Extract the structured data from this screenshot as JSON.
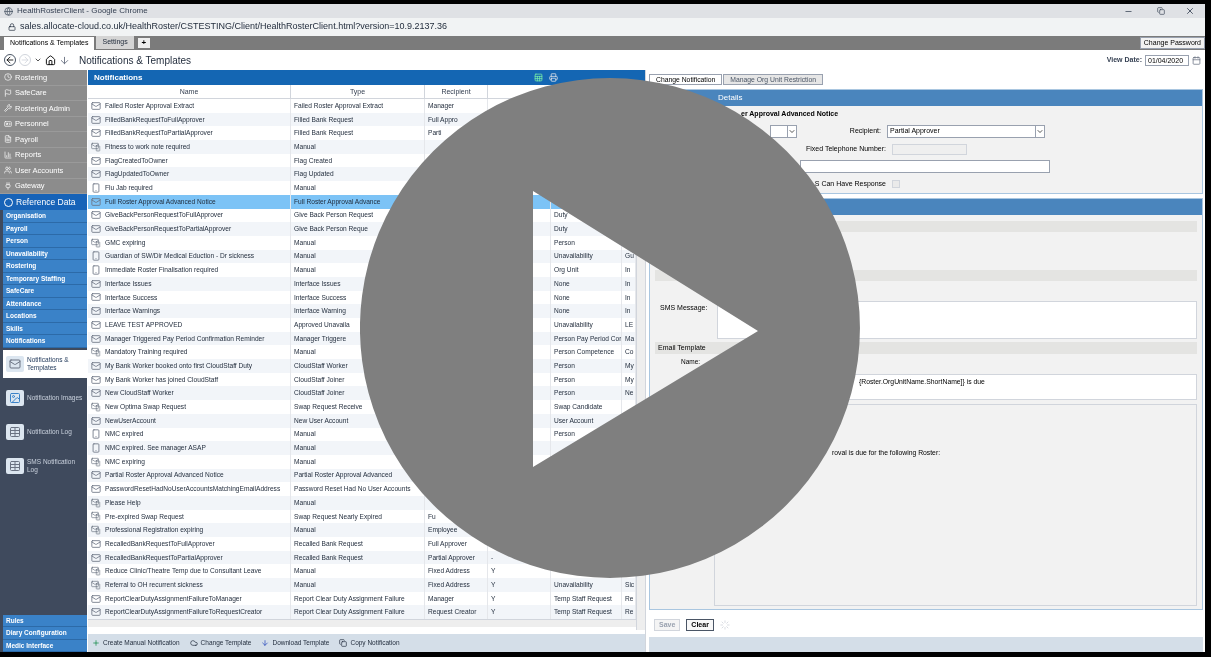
{
  "browser": {
    "title": "HealthRosterClient - Google Chrome",
    "url": "sales.allocate-cloud.co.uk/HealthRoster/CSTESTING/Client/HealthRosterClient.html?version=10.9.2137.36"
  },
  "app_tabs": [
    {
      "label": "Notifications & Templates",
      "selected": true
    },
    {
      "label": "Settings",
      "selected": false
    }
  ],
  "add_tab": "+",
  "change_password": "Change Password",
  "toolbar": {
    "title": "Notifications & Templates",
    "view_date_label": "View Date:",
    "view_date": "01/04/2020"
  },
  "sidebar": {
    "modules": [
      {
        "label": "Rostering"
      },
      {
        "label": "SafeCare"
      },
      {
        "label": "Rostering Admin"
      },
      {
        "label": "Personnel"
      },
      {
        "label": "Payroll"
      },
      {
        "label": "Reports"
      },
      {
        "label": "User Accounts"
      },
      {
        "label": "Gateway"
      }
    ],
    "reference": "Reference Data",
    "categories": [
      {
        "label": "Organisation"
      },
      {
        "label": "Payroll"
      },
      {
        "label": "Person"
      },
      {
        "label": "Unavailability"
      },
      {
        "label": "Rostering"
      },
      {
        "label": "Temporary Staffing"
      },
      {
        "label": "SafeCare"
      },
      {
        "label": "Attendance"
      },
      {
        "label": "Locations"
      },
      {
        "label": "Skills"
      },
      {
        "label": "Notifications"
      }
    ],
    "pages": [
      {
        "label": "Notifications & Templates",
        "selected": true
      },
      {
        "label": "Notification Images",
        "selected": false
      },
      {
        "label": "Notification Log",
        "selected": false
      },
      {
        "label": "SMS Notification Log",
        "selected": false
      }
    ],
    "bottom": [
      {
        "label": "Rules"
      },
      {
        "label": "Diary Configuration"
      },
      {
        "label": "Medic Interface"
      }
    ]
  },
  "grid": {
    "title": "Notifications",
    "columns": [
      "Name",
      "Type",
      "Recipient"
    ],
    "rows": [
      {
        "kind": "email",
        "selected": false,
        "cells": {
          "name": "Failed Roster Approval Extract",
          "type": "Failed Roster Approval Extract",
          "recipient": "Manager"
        }
      },
      {
        "kind": "email",
        "selected": false,
        "cells": {
          "name": "FilledBankRequestToFullApprover",
          "type": "Filled Bank Request",
          "recipient": "Full Appro"
        }
      },
      {
        "kind": "email",
        "selected": false,
        "cells": {
          "name": "FilledBankRequestToPartialApprover",
          "type": "Filled Bank Request",
          "recipient": "Parti"
        }
      },
      {
        "kind": "both",
        "selected": false,
        "cells": {
          "name": "Fitness to work note required",
          "type": "Manual"
        }
      },
      {
        "kind": "email",
        "selected": false,
        "cells": {
          "name": "FlagCreatedToOwner",
          "type": "Flag Created"
        }
      },
      {
        "kind": "email",
        "selected": false,
        "cells": {
          "name": "FlagUpdatedToOwner",
          "type": "Flag Updated"
        }
      },
      {
        "kind": "mobile",
        "selected": false,
        "cells": {
          "name": "Flu Jab required",
          "type": "Manual"
        }
      },
      {
        "kind": "email",
        "selected": true,
        "cells": {
          "name": "Full Roster Approval Advanced Notice",
          "type": "Full Roster Approval Advance"
        }
      },
      {
        "kind": "email",
        "selected": false,
        "cells": {
          "name": "GiveBackPersonRequestToFullApprover",
          "type": "Give Back Person Request",
          "column_5": "Duty"
        }
      },
      {
        "kind": "email",
        "selected": false,
        "cells": {
          "name": "GiveBackPersonRequestToPartialApprover",
          "type": "Give Back Person Reque",
          "column_5": "Duty"
        }
      },
      {
        "kind": "both",
        "selected": false,
        "cells": {
          "name": "GMC expiring",
          "type": "Manual",
          "column_5": "Person"
        }
      },
      {
        "kind": "mobile",
        "selected": false,
        "cells": {
          "name": "Guardian of SW/Dir Medical Eduction - Dr sickness",
          "type": "Manual",
          "column_5": "Unavailability",
          "column_6": "Gu"
        }
      },
      {
        "kind": "mobile",
        "selected": false,
        "cells": {
          "name": "Immediate Roster Finalisation required",
          "type": "Manual",
          "column_5": "Org Unit",
          "column_6": "In"
        }
      },
      {
        "kind": "email",
        "selected": false,
        "cells": {
          "name": "Interface Issues",
          "type": "Interface Issues",
          "column_5": "None",
          "column_6": "In"
        }
      },
      {
        "kind": "email",
        "selected": false,
        "cells": {
          "name": "Interface Success",
          "type": "Interface Success",
          "column_5": "None",
          "column_6": "In"
        }
      },
      {
        "kind": "email",
        "selected": false,
        "cells": {
          "name": "Interface Warnings",
          "type": "Interface Warning",
          "column_5": "None",
          "column_6": "In"
        }
      },
      {
        "kind": "email",
        "selected": false,
        "cells": {
          "name": "LEAVE TEST APPROVED",
          "type": "Approved Unavaila",
          "column_5": "Unavailability",
          "column_6": "LE"
        }
      },
      {
        "kind": "email",
        "selected": false,
        "cells": {
          "name": "Manager Triggered Pay Period Confirmation Reminder",
          "type": "Manager Triggere",
          "column_5": "Person Pay Period Cor",
          "column_6": "Ma"
        }
      },
      {
        "kind": "both",
        "selected": false,
        "cells": {
          "name": "Mandatory Training required",
          "type": "Manual",
          "column_5": "Person Competence",
          "column_6": "Co"
        }
      },
      {
        "kind": "email",
        "selected": false,
        "cells": {
          "name": "My Bank Worker booked onto first CloudStaff Duty",
          "type": "CloudStaff Worker",
          "column_5": "Person",
          "column_6": "My"
        }
      },
      {
        "kind": "email",
        "selected": false,
        "cells": {
          "name": "My Bank Worker has joined CloudStaff",
          "type": "CloudStaff Joiner",
          "column_5": "Person",
          "column_6": "My"
        }
      },
      {
        "kind": "email",
        "selected": false,
        "cells": {
          "name": "New CloudStaff Worker",
          "type": "CloudStaff Joiner",
          "column_5": "Person",
          "column_6": "Ne"
        }
      },
      {
        "kind": "both",
        "selected": false,
        "cells": {
          "name": "New Optima Swap Request",
          "type": "Swap Request Receive",
          "column_5": "Swap Candidate"
        }
      },
      {
        "kind": "email",
        "selected": false,
        "cells": {
          "name": "NewUserAccount",
          "type": "New User Account",
          "column_5": "User Account"
        }
      },
      {
        "kind": "mobile",
        "selected": false,
        "cells": {
          "name": "NMC expired",
          "type": "Manual",
          "column_5": "Person"
        }
      },
      {
        "kind": "mobile",
        "selected": false,
        "cells": {
          "name": "NMC expired. See manager ASAP",
          "type": "Manual"
        }
      },
      {
        "kind": "both",
        "selected": false,
        "cells": {
          "name": "NMC expiring",
          "type": "Manual"
        }
      },
      {
        "kind": "email",
        "selected": false,
        "cells": {
          "name": "Partial Roster Approval Advanced Notice",
          "type": "Partial Roster Approval Advanced"
        }
      },
      {
        "kind": "email",
        "selected": false,
        "cells": {
          "name": "PasswordResetHadNoUserAccountsMatchingEmailAddress",
          "type": "Password Reset Had No User Accounts"
        }
      },
      {
        "kind": "both",
        "selected": false,
        "cells": {
          "name": "Please Help",
          "type": "Manual"
        }
      },
      {
        "kind": "both",
        "selected": false,
        "cells": {
          "name": "Pre-expired Swap Request",
          "type": "Swap Request Nearly Expired",
          "recipient": "Fu"
        }
      },
      {
        "kind": "both",
        "selected": false,
        "cells": {
          "name": "Professional Registration expiring",
          "type": "Manual",
          "recipient": "Employee"
        }
      },
      {
        "kind": "email",
        "selected": false,
        "cells": {
          "name": "RecalledBankRequestToFullApprover",
          "type": "Recalled Bank Request",
          "recipient": "Full Approver"
        }
      },
      {
        "kind": "email",
        "selected": false,
        "cells": {
          "name": "RecalledBankRequestToPartialApprover",
          "type": "Recalled Bank Request",
          "recipient": "Partial Approver",
          "column_4": "-"
        }
      },
      {
        "kind": "both",
        "selected": false,
        "cells": {
          "name": "Reduce Clinic/Theatre Temp due to Consultant Leave",
          "type": "Manual",
          "recipient": "Fixed Address",
          "column_4": "Y"
        }
      },
      {
        "kind": "both",
        "selected": false,
        "cells": {
          "name": "Referral to OH recurrent sickness",
          "type": "Manual",
          "recipient": "Fixed Address",
          "column_4": "Y",
          "column_5": "Unavailability",
          "column_6": "Sic"
        }
      },
      {
        "kind": "email",
        "selected": false,
        "cells": {
          "name": "ReportClearDutyAssignmentFailureToManager",
          "type": "Report Clear Duty Assignment Failure",
          "recipient": "Manager",
          "column_4": "Y",
          "column_5": "Temp Staff Request",
          "column_6": "Re"
        }
      },
      {
        "kind": "email",
        "selected": false,
        "cells": {
          "name": "ReportClearDutyAssignmentFailureToRequestCreator",
          "type": "Report Clear Duty Assignment Failure",
          "recipient": "Request Creator",
          "column_4": "Y",
          "column_5": "Temp Staff Request",
          "column_6": "Re"
        }
      }
    ]
  },
  "footer_actions": [
    "Create Manual Notification",
    "Change Template",
    "Download Template",
    "Copy Notification"
  ],
  "detail": {
    "tabs": [
      {
        "label": "Change Notification",
        "selected": true
      },
      {
        "label": "Manage Org Unit Restriction",
        "selected": false
      }
    ],
    "section_title": "Details",
    "notification_name": "er Approval Advanced Notice",
    "recipient_label": "Recipient:",
    "recipient_value": "Partial Approver",
    "phone_label": "Fixed Telephone Number:",
    "response_label": "S Can Have Response",
    "response_checked": false,
    "sms_label": "SMS Message:",
    "email_template_label": "Email Template",
    "name_label": "Name:",
    "subject_value": "{Roster.OrgUnitName.ShortName]} is due",
    "body_text": "roval is due for the following Roster:",
    "buttons": [
      {
        "label": "Save",
        "disabled": true
      },
      {
        "label": "Clear",
        "disabled": false
      }
    ]
  },
  "play_overlay": {
    "kind": "play"
  }
}
